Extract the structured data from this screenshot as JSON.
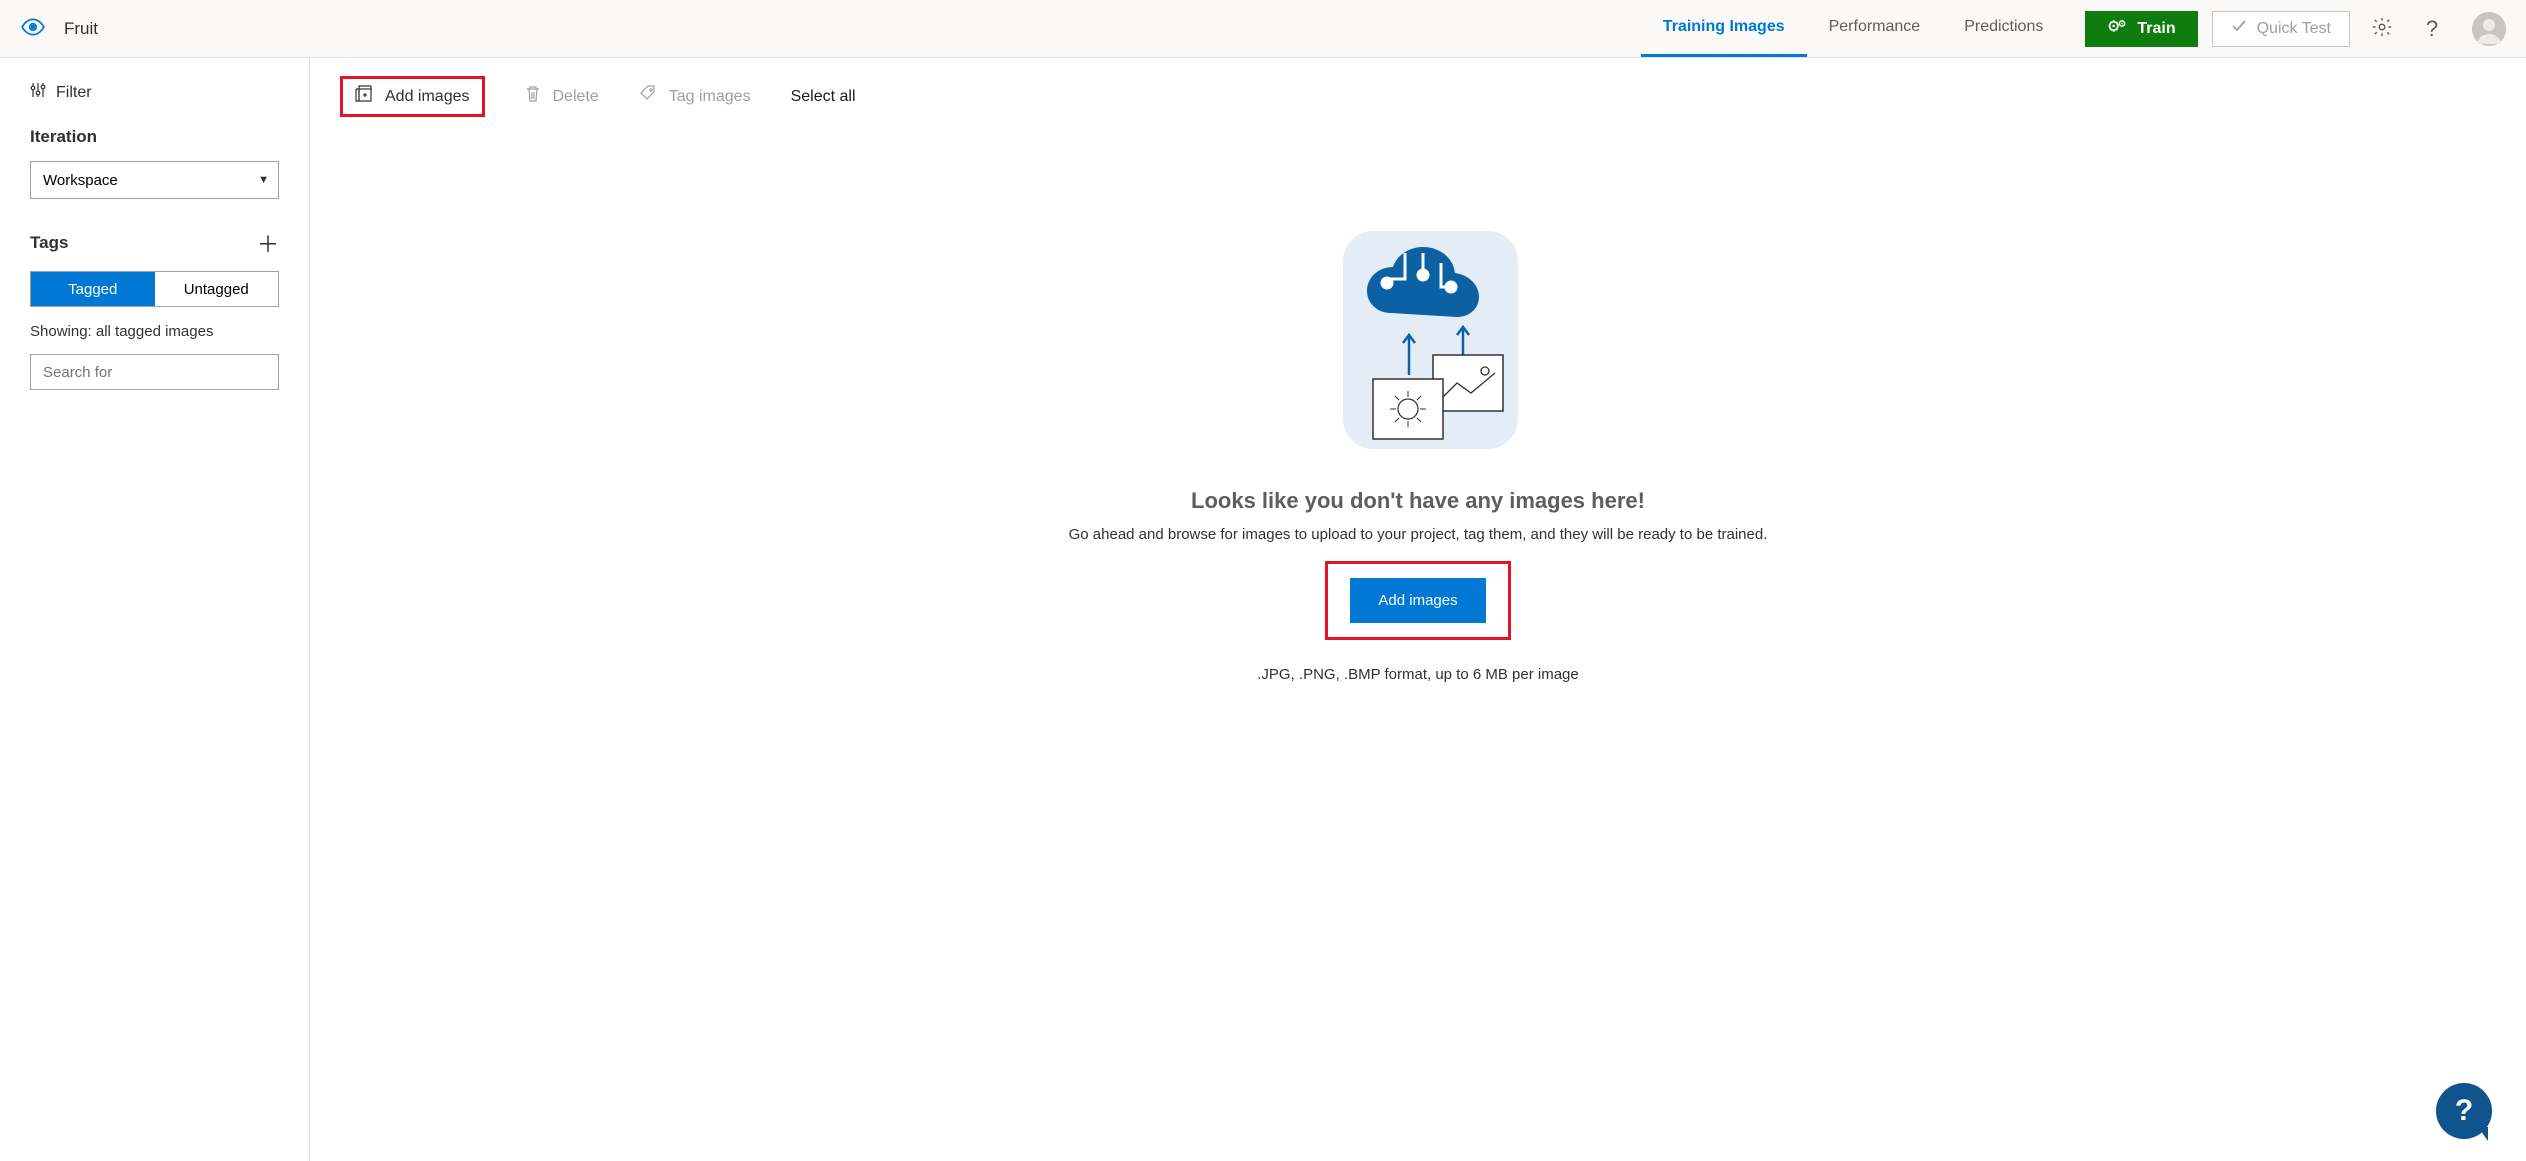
{
  "header": {
    "project_name": "Fruit",
    "tabs": [
      {
        "label": "Training Images",
        "active": true
      },
      {
        "label": "Performance",
        "active": false
      },
      {
        "label": "Predictions",
        "active": false
      }
    ],
    "train_label": "Train",
    "quick_test_label": "Quick Test"
  },
  "sidebar": {
    "filter_label": "Filter",
    "iteration_label": "Iteration",
    "iteration_value": "Workspace",
    "tags_label": "Tags",
    "toggle": {
      "tagged": "Tagged",
      "untagged": "Untagged",
      "active": "tagged"
    },
    "showing_text": "Showing: all tagged images",
    "search_placeholder": "Search for"
  },
  "toolbar": {
    "add_images": "Add images",
    "delete": "Delete",
    "tag_images": "Tag images",
    "select_all": "Select all"
  },
  "empty": {
    "title": "Looks like you don't have any images here!",
    "subtitle": "Go ahead and browse for images to upload to your project, tag them, and they will be ready to be trained.",
    "button": "Add images",
    "format": ".JPG, .PNG, .BMP format, up to 6 MB per image"
  },
  "icons": {
    "eye": "eye-icon",
    "gears": "gears-icon",
    "check": "check-icon",
    "settings": "gear-icon",
    "help": "help-icon",
    "filter": "filter-sliders-icon",
    "plus": "plus-icon",
    "add_images": "add-images-icon",
    "trash": "trash-icon",
    "tag": "tag-icon"
  }
}
